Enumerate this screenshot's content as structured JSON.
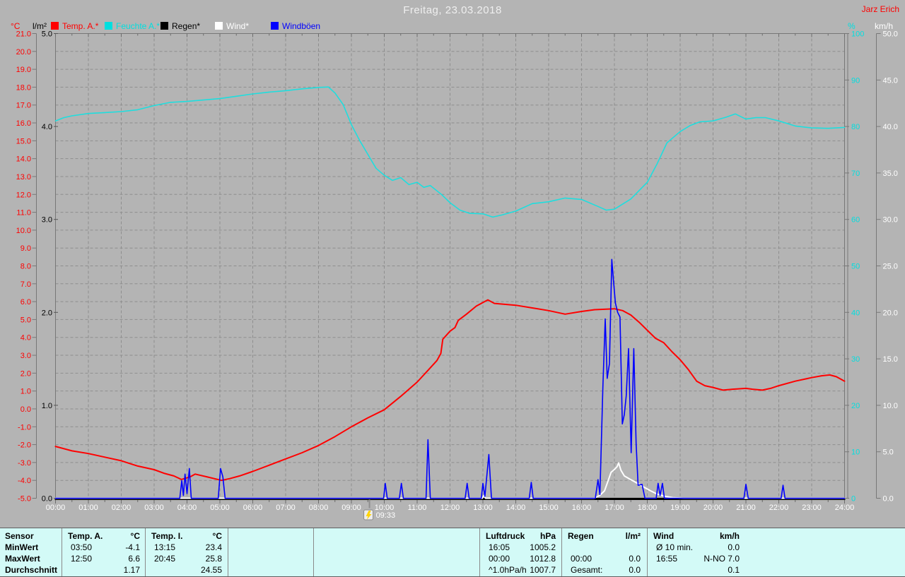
{
  "header": {
    "title": "Freitag, 23.03.2018",
    "title_color": "#efefef",
    "author": "Jarz Erich",
    "author_color": "#ff0000"
  },
  "legend": {
    "left_units": [
      {
        "label": "°C",
        "color": "#ff0000"
      },
      {
        "label": "l/m²",
        "color": "#000000"
      }
    ],
    "right_units": [
      {
        "label": "%",
        "color": "#00dfdf"
      },
      {
        "label": "km/h",
        "color": "#ffffff"
      }
    ],
    "items": [
      {
        "label": "Temp. A.*",
        "color": "#ff0000"
      },
      {
        "label": "Feuchte A.*",
        "color": "#00dfdf"
      },
      {
        "label": "Regen*",
        "color": "#000000"
      },
      {
        "label": "Wind*",
        "color": "#ffffff"
      },
      {
        "label": "Windböen",
        "color": "#0000ff"
      }
    ]
  },
  "chart_data": {
    "type": "line",
    "title": "Freitag, 23.03.2018",
    "grid": true,
    "legend_position": "top",
    "x_axis": {
      "label": "time",
      "min_hour": 0,
      "max_hour": 24
    },
    "x_tick_labels": [
      "00:00",
      "01:00",
      "02:00",
      "03:00",
      "04:00",
      "05:00",
      "06:00",
      "07:00",
      "08:00",
      "09:00",
      "10:00",
      "11:00",
      "12:00",
      "13:00",
      "14:00",
      "15:00",
      "16:00",
      "17:00",
      "18:00",
      "19:00",
      "20:00",
      "21:00",
      "22:00",
      "23:00",
      "24:00"
    ],
    "axes": {
      "temp": {
        "unit": "°C",
        "color": "#ff0000",
        "min": -5,
        "max": 21,
        "step": 1,
        "tick_labels": [
          "21.0",
          "20.0",
          "19.0",
          "18.0",
          "17.0",
          "16.0",
          "15.0",
          "14.0",
          "13.0",
          "12.0",
          "11.0",
          "10.0",
          "9.0",
          "8.0",
          "7.0",
          "6.0",
          "5.0",
          "4.0",
          "3.0",
          "2.0",
          "1.0",
          "0.0",
          "-1.0",
          "-2.0",
          "-3.0",
          "-4.0",
          "-5.0"
        ]
      },
      "rain": {
        "unit": "l/m²",
        "color": "#000000",
        "min": 0,
        "max": 5,
        "step": 1,
        "tick_labels": [
          "5.0",
          "4.0",
          "3.0",
          "2.0",
          "1.0",
          "0.0"
        ]
      },
      "humidity": {
        "unit": "%",
        "color": "#00dfdf",
        "min": 0,
        "max": 100,
        "step": 10,
        "tick_labels": [
          "100",
          "90",
          "80",
          "70",
          "60",
          "50",
          "40",
          "30",
          "20",
          "10",
          "0"
        ]
      },
      "wind": {
        "unit": "km/h",
        "color": "#ffffff",
        "min": 0,
        "max": 50,
        "step": 5,
        "tick_labels": [
          "50.0",
          "45.0",
          "40.0",
          "35.0",
          "30.0",
          "25.0",
          "20.0",
          "15.0",
          "10.0",
          "5.0",
          "0.0"
        ]
      }
    },
    "cursor": {
      "time_label": "09:33",
      "hour": 9.55
    },
    "series": [
      {
        "id": "regen",
        "name": "Regen*",
        "axis": "rain",
        "color": "#000000",
        "points": [
          [
            0,
            0
          ],
          [
            24,
            0
          ]
        ]
      },
      {
        "id": "feuchte",
        "name": "Feuchte A.*",
        "axis": "humidity",
        "color": "#1edede",
        "points": [
          [
            0,
            81.2
          ],
          [
            0.25,
            81.9
          ],
          [
            0.5,
            82.3
          ],
          [
            1,
            82.8
          ],
          [
            1.5,
            83.0
          ],
          [
            2,
            83.2
          ],
          [
            2.5,
            83.6
          ],
          [
            3,
            84.5
          ],
          [
            3.5,
            85.2
          ],
          [
            4,
            85.4
          ],
          [
            4.5,
            85.7
          ],
          [
            5,
            86.0
          ],
          [
            5.5,
            86.5
          ],
          [
            6,
            87.0
          ],
          [
            6.5,
            87.4
          ],
          [
            7,
            87.7
          ],
          [
            7.5,
            88.1
          ],
          [
            8,
            88.4
          ],
          [
            8.3,
            88.5
          ],
          [
            8.5,
            87.2
          ],
          [
            8.75,
            84.7
          ],
          [
            9,
            80.4
          ],
          [
            9.25,
            77.0
          ],
          [
            9.5,
            74.0
          ],
          [
            9.75,
            71.0
          ],
          [
            10,
            69.5
          ],
          [
            10.25,
            68.4
          ],
          [
            10.5,
            69.0
          ],
          [
            10.75,
            67.5
          ],
          [
            11,
            68.0
          ],
          [
            11.2,
            66.9
          ],
          [
            11.4,
            67.3
          ],
          [
            11.75,
            65.3
          ],
          [
            12,
            63.6
          ],
          [
            12.3,
            62.0
          ],
          [
            12.6,
            61.3
          ],
          [
            13,
            61.2
          ],
          [
            13.3,
            60.5
          ],
          [
            13.6,
            61.0
          ],
          [
            14,
            61.8
          ],
          [
            14.5,
            63.4
          ],
          [
            15,
            63.8
          ],
          [
            15.5,
            64.6
          ],
          [
            16,
            64.3
          ],
          [
            16.5,
            62.8
          ],
          [
            16.75,
            62.0
          ],
          [
            17,
            62.2
          ],
          [
            17.5,
            64.4
          ],
          [
            18,
            68.0
          ],
          [
            18.3,
            72.0
          ],
          [
            18.6,
            76.5
          ],
          [
            19,
            78.9
          ],
          [
            19.3,
            80.2
          ],
          [
            19.6,
            81.0
          ],
          [
            20,
            81.2
          ],
          [
            20.4,
            82.0
          ],
          [
            20.68,
            82.7
          ],
          [
            21,
            81.6
          ],
          [
            21.3,
            81.9
          ],
          [
            21.6,
            81.9
          ],
          [
            22,
            81.2
          ],
          [
            22.5,
            80.1
          ],
          [
            23,
            79.7
          ],
          [
            23.5,
            79.6
          ],
          [
            24,
            79.8
          ]
        ]
      },
      {
        "id": "temp",
        "name": "Temp. A.*",
        "axis": "temp",
        "color": "#ff0000",
        "points": [
          [
            0,
            -2.1
          ],
          [
            0.5,
            -2.35
          ],
          [
            1,
            -2.5
          ],
          [
            1.5,
            -2.7
          ],
          [
            2,
            -2.9
          ],
          [
            2.5,
            -3.2
          ],
          [
            3,
            -3.4
          ],
          [
            3.3,
            -3.6
          ],
          [
            3.6,
            -3.75
          ],
          [
            3.83,
            -3.95
          ],
          [
            4.1,
            -3.8
          ],
          [
            4.25,
            -3.65
          ],
          [
            4.6,
            -3.8
          ],
          [
            5.05,
            -4.0
          ],
          [
            5.3,
            -3.9
          ],
          [
            5.6,
            -3.75
          ],
          [
            6,
            -3.5
          ],
          [
            6.5,
            -3.15
          ],
          [
            7,
            -2.8
          ],
          [
            7.5,
            -2.45
          ],
          [
            8,
            -2.05
          ],
          [
            8.5,
            -1.55
          ],
          [
            9,
            -1.0
          ],
          [
            9.5,
            -0.5
          ],
          [
            10,
            -0.05
          ],
          [
            10.5,
            0.7
          ],
          [
            11,
            1.5
          ],
          [
            11.35,
            2.2
          ],
          [
            11.6,
            2.7
          ],
          [
            11.72,
            3.1
          ],
          [
            11.78,
            3.9
          ],
          [
            12,
            4.35
          ],
          [
            12.15,
            4.55
          ],
          [
            12.25,
            4.95
          ],
          [
            12.5,
            5.3
          ],
          [
            12.8,
            5.75
          ],
          [
            13.05,
            6.0
          ],
          [
            13.15,
            6.1
          ],
          [
            13.35,
            5.9
          ],
          [
            14,
            5.8
          ],
          [
            14.5,
            5.65
          ],
          [
            15,
            5.5
          ],
          [
            15.5,
            5.3
          ],
          [
            16,
            5.45
          ],
          [
            16.4,
            5.55
          ],
          [
            17,
            5.6
          ],
          [
            17.25,
            5.5
          ],
          [
            17.5,
            5.25
          ],
          [
            17.75,
            4.85
          ],
          [
            18,
            4.4
          ],
          [
            18.25,
            3.95
          ],
          [
            18.5,
            3.7
          ],
          [
            18.75,
            3.2
          ],
          [
            19,
            2.75
          ],
          [
            19.25,
            2.2
          ],
          [
            19.5,
            1.55
          ],
          [
            19.75,
            1.3
          ],
          [
            20,
            1.2
          ],
          [
            20.3,
            1.05
          ],
          [
            20.6,
            1.1
          ],
          [
            21,
            1.15
          ],
          [
            21.2,
            1.1
          ],
          [
            21.5,
            1.05
          ],
          [
            21.75,
            1.15
          ],
          [
            22,
            1.3
          ],
          [
            22.5,
            1.55
          ],
          [
            23,
            1.75
          ],
          [
            23.3,
            1.85
          ],
          [
            23.55,
            1.9
          ],
          [
            23.75,
            1.8
          ],
          [
            24,
            1.55
          ]
        ]
      },
      {
        "id": "wind",
        "name": "Wind*",
        "axis": "wind",
        "color": "#ffffff",
        "points": [
          [
            0,
            0
          ],
          [
            12.98,
            0
          ],
          [
            13.03,
            0.3
          ],
          [
            13.08,
            0
          ],
          [
            16.38,
            0
          ],
          [
            16.55,
            0.3
          ],
          [
            16.7,
            0.8
          ],
          [
            16.8,
            1.8
          ],
          [
            16.9,
            2.8
          ],
          [
            17.0,
            3.1
          ],
          [
            17.08,
            3.4
          ],
          [
            17.13,
            3.8
          ],
          [
            17.2,
            3.0
          ],
          [
            17.3,
            2.4
          ],
          [
            17.45,
            2.1
          ],
          [
            17.6,
            1.8
          ],
          [
            17.75,
            1.5
          ],
          [
            17.9,
            1.2
          ],
          [
            18.1,
            0.8
          ],
          [
            18.3,
            0.45
          ],
          [
            18.55,
            0.2
          ],
          [
            18.8,
            0.05
          ],
          [
            19.1,
            0
          ],
          [
            24,
            0
          ]
        ]
      },
      {
        "id": "windboeen",
        "name": "Windböen",
        "axis": "wind",
        "color": "#0000ff",
        "points": [
          [
            0,
            0
          ],
          [
            3.78,
            0
          ],
          [
            3.84,
            1.9
          ],
          [
            3.89,
            0.3
          ],
          [
            3.94,
            2.6
          ],
          [
            4.0,
            0.5
          ],
          [
            4.07,
            3.2
          ],
          [
            4.13,
            0
          ],
          [
            4.95,
            0
          ],
          [
            5.02,
            3.2
          ],
          [
            5.09,
            2.3
          ],
          [
            5.16,
            0
          ],
          [
            9.98,
            0
          ],
          [
            10.03,
            1.6
          ],
          [
            10.09,
            0
          ],
          [
            10.46,
            0
          ],
          [
            10.52,
            1.6
          ],
          [
            10.58,
            0
          ],
          [
            11.27,
            0
          ],
          [
            11.33,
            6.3
          ],
          [
            11.4,
            0
          ],
          [
            12.46,
            0
          ],
          [
            12.52,
            1.6
          ],
          [
            12.58,
            0
          ],
          [
            12.95,
            0
          ],
          [
            13.0,
            1.6
          ],
          [
            13.06,
            0.2
          ],
          [
            13.18,
            4.7
          ],
          [
            13.26,
            0
          ],
          [
            14.41,
            0
          ],
          [
            14.47,
            1.7
          ],
          [
            14.53,
            0
          ],
          [
            16.42,
            0
          ],
          [
            16.5,
            2.0
          ],
          [
            16.56,
            0.4
          ],
          [
            16.65,
            12
          ],
          [
            16.72,
            19.3
          ],
          [
            16.78,
            12.9
          ],
          [
            16.85,
            14.5
          ],
          [
            16.92,
            25.7
          ],
          [
            16.97,
            23.5
          ],
          [
            17.03,
            21
          ],
          [
            17.1,
            20
          ],
          [
            17.17,
            19.5
          ],
          [
            17.24,
            8
          ],
          [
            17.3,
            9
          ],
          [
            17.36,
            11
          ],
          [
            17.43,
            16.1
          ],
          [
            17.51,
            4.9
          ],
          [
            17.59,
            16.1
          ],
          [
            17.66,
            5.9
          ],
          [
            17.72,
            1.4
          ],
          [
            17.84,
            1.5
          ],
          [
            17.93,
            0
          ],
          [
            18.27,
            0
          ],
          [
            18.33,
            1.6
          ],
          [
            18.39,
            0.3
          ],
          [
            18.46,
            1.6
          ],
          [
            18.52,
            0
          ],
          [
            20.94,
            0
          ],
          [
            21.0,
            1.5
          ],
          [
            21.07,
            0
          ],
          [
            22.07,
            0
          ],
          [
            22.13,
            1.4
          ],
          [
            22.19,
            0
          ],
          [
            24,
            0
          ]
        ]
      }
    ]
  },
  "table": {
    "row_labels": [
      "Sensor",
      "MinWert",
      "MaxWert",
      "Durchschnitt"
    ],
    "groups": [
      {
        "name": "Temp. A.",
        "unit": "°C",
        "rows": [
          [
            "03:50",
            "-4.1"
          ],
          [
            "12:50",
            "6.6"
          ],
          [
            "",
            "1.17"
          ]
        ]
      },
      {
        "name": "Temp. I.",
        "unit": "°C",
        "rows": [
          [
            "13:15",
            "23.4"
          ],
          [
            "20:45",
            "25.8"
          ],
          [
            "",
            "24.55"
          ]
        ]
      },
      {
        "name": "Luftdruck",
        "unit": "hPa",
        "rows": [
          [
            "16:05",
            "1005.2"
          ],
          [
            "00:00",
            "1012.8"
          ],
          [
            "^1.0hPa/h",
            "1007.7"
          ]
        ]
      },
      {
        "name": "Regen",
        "unit": "l/m²",
        "rows": [
          [
            "",
            ""
          ],
          [
            "00:00",
            "0.0"
          ],
          [
            "Gesamt:",
            "0.0"
          ]
        ]
      },
      {
        "name": "Wind",
        "unit": "km/h",
        "rows": [
          [
            "Ø 10 min.",
            "0.0"
          ],
          [
            "16:55",
            "N-NO 7.0"
          ],
          [
            "",
            "0.1"
          ]
        ]
      }
    ]
  }
}
